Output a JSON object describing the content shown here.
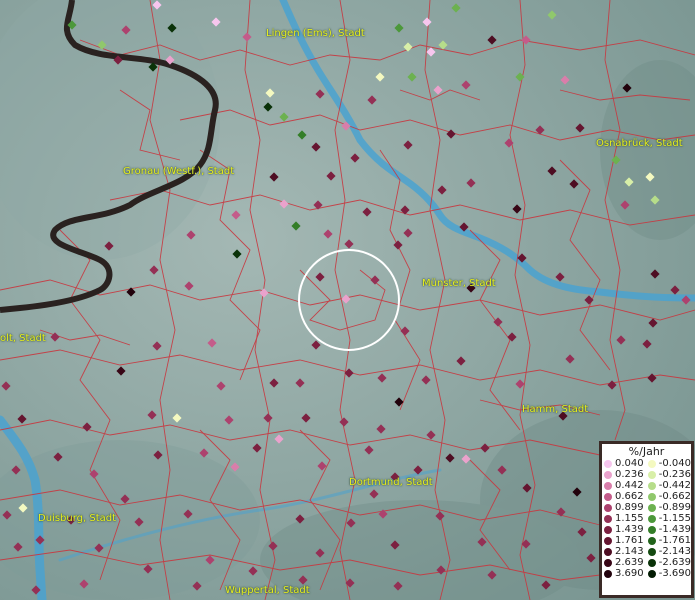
{
  "labels": [
    {
      "id": "lingen",
      "text": "Lingen (Ems), Stadt"
    },
    {
      "id": "osnabrueck",
      "text": "Osnabrück, Stadt"
    },
    {
      "id": "gronau",
      "text": "Gronau (Westf.), Stadt"
    },
    {
      "id": "muenster",
      "text": "Münster, Stadt"
    },
    {
      "id": "bocholt",
      "text": "olt, Stadt"
    },
    {
      "id": "hamm",
      "text": "Hamm, Stadt"
    },
    {
      "id": "dortmund",
      "text": "Dortmund, Stadt"
    },
    {
      "id": "duisburg",
      "text": "Duisburg, Stadt"
    },
    {
      "id": "wuppertal",
      "text": "Wuppertal, Stadt"
    }
  ],
  "legend": {
    "title": "%/Jahr",
    "positive": [
      {
        "label": "0.040",
        "color": "#f7c6ee"
      },
      {
        "label": "0.236",
        "color": "#eaa2cc"
      },
      {
        "label": "0.442",
        "color": "#d97eaa"
      },
      {
        "label": "0.662",
        "color": "#c45c8a"
      },
      {
        "label": "0.899",
        "color": "#ad426e"
      },
      {
        "label": "1.155",
        "color": "#943055"
      },
      {
        "label": "1.439",
        "color": "#7c2040"
      },
      {
        "label": "1.761",
        "color": "#651530"
      },
      {
        "label": "2.143",
        "color": "#4e0d22"
      },
      {
        "label": "2.639",
        "color": "#380616"
      },
      {
        "label": "3.690",
        "color": "#22020c"
      }
    ],
    "negative": [
      {
        "label": "-0.040",
        "color": "#f4f9c0"
      },
      {
        "label": "-0.236",
        "color": "#d8efa8"
      },
      {
        "label": "-0.442",
        "color": "#b6dd8a"
      },
      {
        "label": "-0.662",
        "color": "#90c86c"
      },
      {
        "label": "-0.899",
        "color": "#6cb150"
      },
      {
        "label": "-1.155",
        "color": "#4c983a"
      },
      {
        "label": "-1.439",
        "color": "#347e28"
      },
      {
        "label": "-1.761",
        "color": "#22641b"
      },
      {
        "label": "-2.143",
        "color": "#144a10"
      },
      {
        "label": "-2.639",
        "color": "#0a3208"
      },
      {
        "label": "-3.690",
        "color": "#031c03"
      }
    ]
  },
  "colors": {
    "terrain": "#7f9b98",
    "river": "#4aa2d0",
    "border_lines": "#c8373f",
    "national_border": "#2a2220",
    "label_text": "#e8f020"
  }
}
